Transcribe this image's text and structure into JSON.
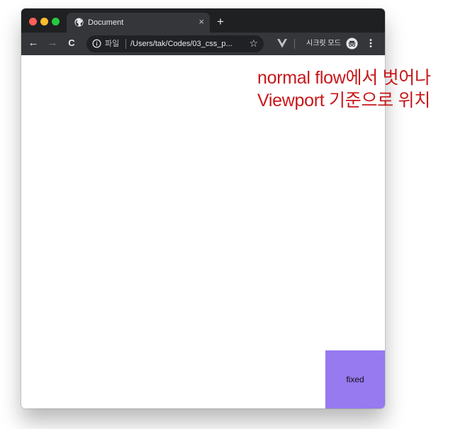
{
  "browser": {
    "tab": {
      "title": "Document",
      "close_icon": "×"
    },
    "new_tab_icon": "+",
    "toolbar": {
      "back_icon": "←",
      "forward_icon": "→",
      "reload_icon": "C",
      "omnibox": {
        "scheme_label": "파일",
        "url": "/Users/tak/Codes/03_css_p...",
        "star_icon": "☆"
      },
      "incognito_label": "시크릿 모드"
    },
    "traffic_lights": {
      "close_color": "#fe5f57",
      "minimize_color": "#febc2e",
      "maximize_color": "#28c840"
    }
  },
  "page": {
    "fixed_box": {
      "label": "fixed",
      "color": "#9779f0"
    }
  },
  "annotation": {
    "line1": "normal flow에서 벗어나",
    "line2": "Viewport 기준으로 위치",
    "color": "#c8171b"
  }
}
